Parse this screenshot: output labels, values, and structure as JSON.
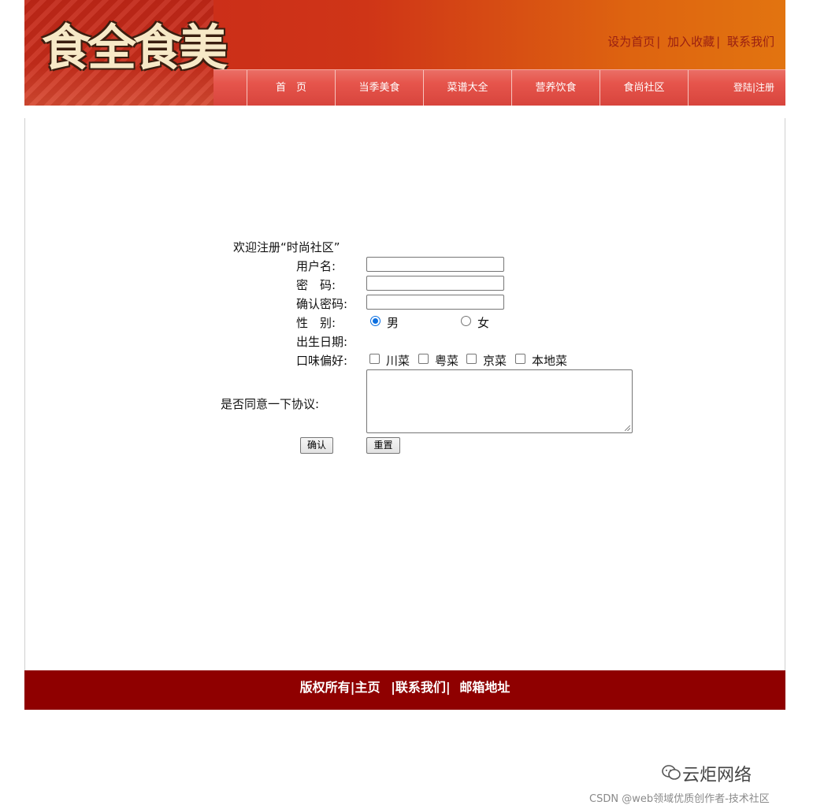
{
  "header": {
    "logo_text": "食全食美",
    "top_links": [
      "设为首页",
      "加入收藏",
      "联系我们"
    ],
    "nav_items": [
      "首　页",
      "当季美食",
      "菜谱大全",
      "营养饮食",
      "食尚社区"
    ],
    "login_link": "登陆|注册"
  },
  "form": {
    "title": "欢迎注册“时尚社区”",
    "username_label": "用户名:",
    "password_label": "密　码:",
    "confirm_label": "确认密码:",
    "gender_label": "性　别:",
    "gender_options": [
      "男",
      "女"
    ],
    "gender_selected": "男",
    "birthdate_label": "出生日期:",
    "taste_label": "口味偏好:",
    "taste_options": [
      "川菜",
      "粤菜",
      "京菜",
      "本地菜"
    ],
    "agreement_label": "是否同意一下协议:",
    "confirm_button": "确认",
    "reset_button": "重置"
  },
  "footer": {
    "links": [
      "版权所有|主页",
      "|联系我们|",
      "邮箱地址"
    ]
  },
  "watermark": {
    "brand": "云炬网络",
    "csdn": "CSDN @web领域优质创作者-技术社区"
  },
  "colors": {
    "header_red": "#c7271b",
    "header_orange": "#e27410",
    "nav_red": "#e6554c",
    "footer_red": "#8f0000",
    "link_red": "#9a2012"
  }
}
